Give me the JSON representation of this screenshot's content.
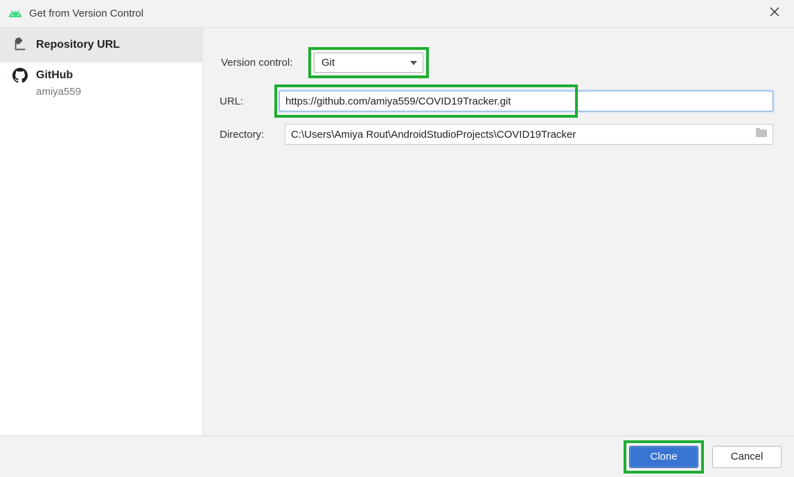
{
  "titlebar": {
    "title": "Get from Version Control"
  },
  "sidebar": {
    "repo_url_label": "Repository URL",
    "github_label": "GitHub",
    "github_user": "amiya559"
  },
  "form": {
    "vc_label": "Version control:",
    "vc_value": "Git",
    "url_label": "URL:",
    "url_value": "https://github.com/amiya559/COVID19Tracker.git",
    "dir_label": "Directory:",
    "dir_value": "C:\\Users\\Amiya Rout\\AndroidStudioProjects\\COVID19Tracker"
  },
  "footer": {
    "clone_label": "Clone",
    "cancel_label": "Cancel"
  }
}
